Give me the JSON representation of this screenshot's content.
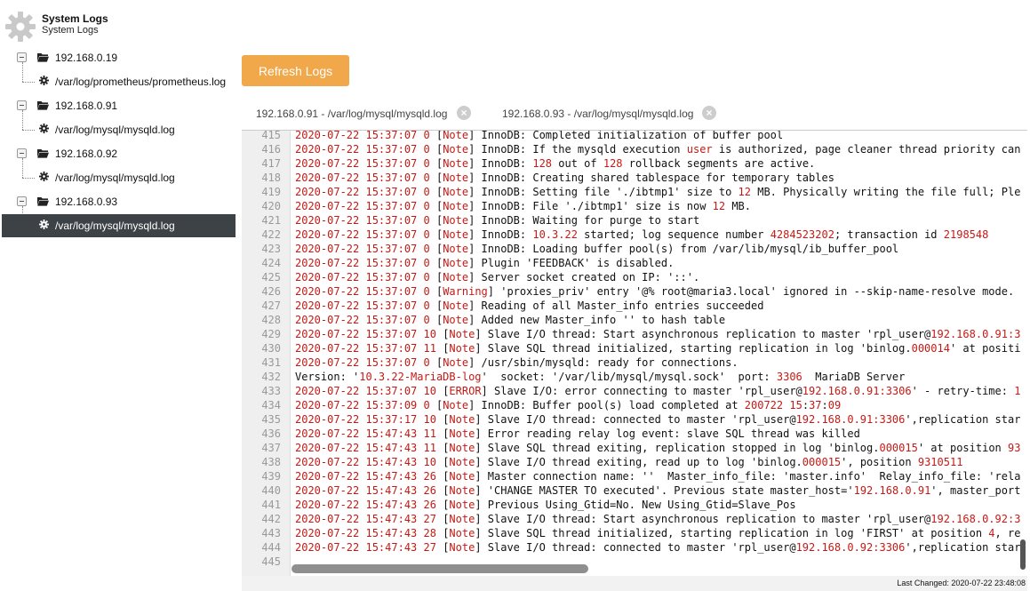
{
  "tree": {
    "root_title": "System Logs",
    "root_subtitle": "System Logs",
    "hosts": [
      {
        "ip": "192.168.0.19",
        "file": "/var/log/prometheus/prometheus.log",
        "selected": false
      },
      {
        "ip": "192.168.0.91",
        "file": "/var/log/mysql/mysqld.log",
        "selected": false
      },
      {
        "ip": "192.168.0.92",
        "file": "/var/log/mysql/mysqld.log",
        "selected": false
      },
      {
        "ip": "192.168.0.93",
        "file": "/var/log/mysql/mysqld.log",
        "selected": true
      }
    ]
  },
  "toolbar": {
    "refresh_label": "Refresh Logs"
  },
  "tabs": [
    {
      "label": "192.168.0.91 - /var/log/mysql/mysqld.log",
      "close": "×"
    },
    {
      "label": "192.168.0.93 - /var/log/mysql/mysqld.log",
      "close": "×"
    }
  ],
  "log": {
    "lines": [
      {
        "n": "415",
        "t": "2020-07-22 15:37:07 0 [Note] InnoDB: Completed initialization of buffer pool"
      },
      {
        "n": "416",
        "t": "2020-07-22 15:37:07 0 [Note] InnoDB: If the mysqld execution user is authorized, page cleaner thread priority can"
      },
      {
        "n": "417",
        "t": "2020-07-22 15:37:07 0 [Note] InnoDB: 128 out of 128 rollback segments are active."
      },
      {
        "n": "418",
        "t": "2020-07-22 15:37:07 0 [Note] InnoDB: Creating shared tablespace for temporary tables"
      },
      {
        "n": "419",
        "t": "2020-07-22 15:37:07 0 [Note] InnoDB: Setting file './ibtmp1' size to 12 MB. Physically writing the file full; Ple"
      },
      {
        "n": "420",
        "t": "2020-07-22 15:37:07 0 [Note] InnoDB: File './ibtmp1' size is now 12 MB."
      },
      {
        "n": "421",
        "t": "2020-07-22 15:37:07 0 [Note] InnoDB: Waiting for purge to start"
      },
      {
        "n": "422",
        "t": "2020-07-22 15:37:07 0 [Note] InnoDB: 10.3.22 started; log sequence number 4284523202; transaction id 2198548"
      },
      {
        "n": "423",
        "t": "2020-07-22 15:37:07 0 [Note] InnoDB: Loading buffer pool(s) from /var/lib/mysql/ib_buffer_pool"
      },
      {
        "n": "424",
        "t": "2020-07-22 15:37:07 0 [Note] Plugin 'FEEDBACK' is disabled."
      },
      {
        "n": "425",
        "t": "2020-07-22 15:37:07 0 [Note] Server socket created on IP: '::'."
      },
      {
        "n": "426",
        "t": "2020-07-22 15:37:07 0 [Warning] 'proxies_priv' entry '@% root@maria3.local' ignored in --skip-name-resolve mode."
      },
      {
        "n": "427",
        "t": "2020-07-22 15:37:07 0 [Note] Reading of all Master_info entries succeeded"
      },
      {
        "n": "428",
        "t": "2020-07-22 15:37:07 0 [Note] Added new Master_info '' to hash table"
      },
      {
        "n": "429",
        "t": "2020-07-22 15:37:07 10 [Note] Slave I/O thread: Start asynchronous replication to master 'rpl_user@192.168.0.91:3"
      },
      {
        "n": "430",
        "t": "2020-07-22 15:37:07 11 [Note] Slave SQL thread initialized, starting replication in log 'binlog.000014' at positi"
      },
      {
        "n": "431",
        "t": "2020-07-22 15:37:07 0 [Note] /usr/sbin/mysqld: ready for connections."
      },
      {
        "n": "432",
        "t": "Version: '10.3.22-MariaDB-log'  socket: '/var/lib/mysql/mysql.sock'  port: 3306  MariaDB Server"
      },
      {
        "n": "433",
        "t": "2020-07-22 15:37:07 10 [ERROR] Slave I/O: error connecting to master 'rpl_user@192.168.0.91:3306' - retry-time: 1"
      },
      {
        "n": "434",
        "t": "2020-07-22 15:37:09 0 [Note] InnoDB: Buffer pool(s) load completed at 200722 15:37:09"
      },
      {
        "n": "435",
        "t": "2020-07-22 15:37:17 10 [Note] Slave I/O thread: connected to master 'rpl_user@192.168.0.91:3306',replication star"
      },
      {
        "n": "436",
        "t": "2020-07-22 15:47:43 11 [Note] Error reading relay log event: slave SQL thread was killed"
      },
      {
        "n": "437",
        "t": "2020-07-22 15:47:43 11 [Note] Slave SQL thread exiting, replication stopped in log 'binlog.000015' at position 93"
      },
      {
        "n": "438",
        "t": "2020-07-22 15:47:43 10 [Note] Slave I/O thread exiting, read up to log 'binlog.000015', position 9310511"
      },
      {
        "n": "439",
        "t": "2020-07-22 15:47:43 26 [Note] Master connection name: ''  Master_info_file: 'master.info'  Relay_info_file: 'rela"
      },
      {
        "n": "440",
        "t": "2020-07-22 15:47:43 26 [Note] 'CHANGE MASTER TO executed'. Previous state master_host='192.168.0.91', master_port"
      },
      {
        "n": "441",
        "t": "2020-07-22 15:47:43 26 [Note] Previous Using_Gtid=No. New Using_Gtid=Slave_Pos"
      },
      {
        "n": "442",
        "t": "2020-07-22 15:47:43 27 [Note] Slave I/O thread: Start asynchronous replication to master 'rpl_user@192.168.0.92:3"
      },
      {
        "n": "443",
        "t": "2020-07-22 15:47:43 28 [Note] Slave SQL thread initialized, starting replication in log 'FIRST' at position 4, re"
      },
      {
        "n": "444",
        "t": "2020-07-22 15:47:43 27 [Note] Slave I/O thread: connected to master 'rpl_user@192.168.0.92:3306',replication star"
      },
      {
        "n": "445",
        "t": ""
      }
    ]
  },
  "status": {
    "last_changed": "Last Changed: 2020-07-22 23:48:08"
  },
  "colors": {
    "accent": "#f0a84a",
    "highlight": "#c41a16",
    "selected_bg": "#3d4246"
  }
}
